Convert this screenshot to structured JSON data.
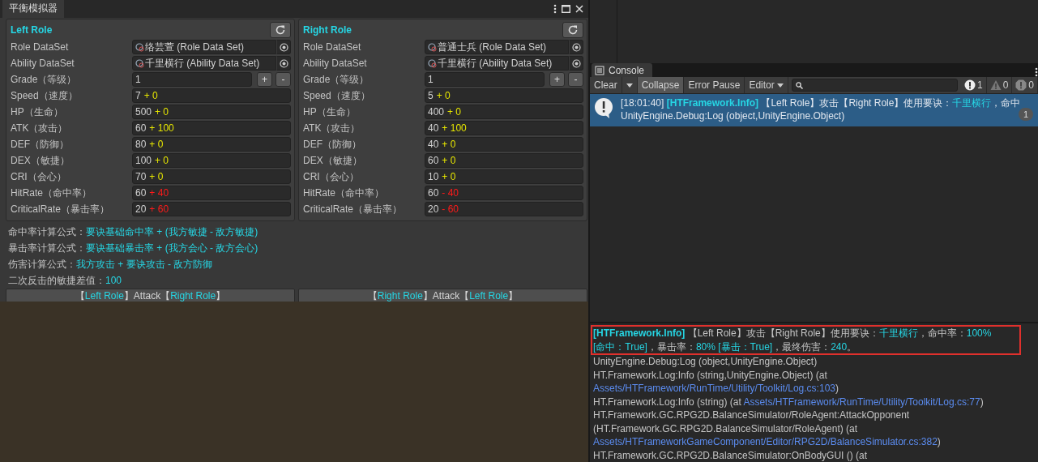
{
  "window": {
    "tab": "平衡模拟器"
  },
  "roles": [
    {
      "title": "Left Role",
      "role_dataset": {
        "label": "Role DataSet",
        "value": "络芸萱 (Role Data Set)"
      },
      "ability_dataset": {
        "label": "Ability DataSet",
        "value": "千里横行 (Ability Data Set)"
      },
      "grade": {
        "label": "Grade（等级）",
        "value": "1",
        "buttons": [
          "+",
          "-"
        ]
      },
      "stats": [
        {
          "label": "Speed（速度）",
          "base": "7",
          "modifier": "+ 0",
          "color": "#e6e600"
        },
        {
          "label": "HP（生命）",
          "base": "500",
          "modifier": "+ 0",
          "color": "#e6e600"
        },
        {
          "label": "ATK（攻击）",
          "base": "60",
          "modifier": "+ 100",
          "color": "#e6e600"
        },
        {
          "label": "DEF（防御）",
          "base": "80",
          "modifier": "+ 0",
          "color": "#e6e600"
        },
        {
          "label": "DEX（敏捷）",
          "base": "100",
          "modifier": "+ 0",
          "color": "#e6e600"
        },
        {
          "label": "CRI（会心）",
          "base": "70",
          "modifier": "+ 0",
          "color": "#e6e600"
        },
        {
          "label": "HitRate（命中率）",
          "base": "60",
          "modifier": "+ 40",
          "color": "#ff1a1a"
        },
        {
          "label": "CriticalRate（暴击率）",
          "base": "20",
          "modifier": "+ 60",
          "color": "#ff1a1a"
        }
      ]
    },
    {
      "title": "Right Role",
      "role_dataset": {
        "label": "Role DataSet",
        "value": "普通士兵 (Role Data Set)"
      },
      "ability_dataset": {
        "label": "Ability DataSet",
        "value": "千里横行 (Ability Data Set)"
      },
      "grade": {
        "label": "Grade（等级）",
        "value": "1",
        "buttons": [
          "+",
          "-"
        ]
      },
      "stats": [
        {
          "label": "Speed（速度）",
          "base": "5",
          "modifier": "+ 0",
          "color": "#e6e600"
        },
        {
          "label": "HP（生命）",
          "base": "400",
          "modifier": "+ 0",
          "color": "#e6e600"
        },
        {
          "label": "ATK（攻击）",
          "base": "40",
          "modifier": "+ 100",
          "color": "#e6e600"
        },
        {
          "label": "DEF（防御）",
          "base": "40",
          "modifier": "+ 0",
          "color": "#e6e600"
        },
        {
          "label": "DEX（敏捷）",
          "base": "60",
          "modifier": "+ 0",
          "color": "#e6e600"
        },
        {
          "label": "CRI（会心）",
          "base": "10",
          "modifier": "+ 0",
          "color": "#e6e600"
        },
        {
          "label": "HitRate（命中率）",
          "base": "60",
          "modifier": "- 40",
          "color": "#ff1a1a"
        },
        {
          "label": "CriticalRate（暴击率）",
          "base": "20",
          "modifier": "- 60",
          "color": "#ff1a1a"
        }
      ]
    }
  ],
  "formulas": [
    {
      "label": "命中率计算公式：",
      "value": "要诀基础命中率 + (我方敏捷 - 敌方敏捷)"
    },
    {
      "label": "暴击率计算公式：",
      "value": "要诀基础暴击率 + (我方会心 - 敌方会心)"
    },
    {
      "label": "伤害计算公式：",
      "value": "我方攻击 + 要诀攻击 - 敌方防御"
    },
    {
      "label": "二次反击的敏捷差值：",
      "value": "100"
    }
  ],
  "attack_buttons": [
    {
      "parts": [
        {
          "text": "【",
          "highlight": false
        },
        {
          "text": "Left Role",
          "highlight": true
        },
        {
          "text": "】Attack【",
          "highlight": false
        },
        {
          "text": "Right Role",
          "highlight": true
        },
        {
          "text": "】",
          "highlight": false
        }
      ]
    },
    {
      "parts": [
        {
          "text": "【",
          "highlight": false
        },
        {
          "text": "Right Role",
          "highlight": true
        },
        {
          "text": "】Attack【",
          "highlight": false
        },
        {
          "text": "Left Role",
          "highlight": true
        },
        {
          "text": "】",
          "highlight": false
        }
      ]
    }
  ],
  "console": {
    "tab": "Console",
    "toolbar": [
      {
        "label": "Clear",
        "kind": "button",
        "selected": false
      },
      {
        "kind": "dropdown",
        "selected": false
      },
      {
        "label": "Collapse",
        "kind": "button",
        "selected": true
      },
      {
        "label": "Error Pause",
        "kind": "button",
        "selected": false
      },
      {
        "label": "Editor",
        "kind": "dropdown",
        "selected": false
      }
    ],
    "counts": [
      {
        "kind": "info",
        "value": "1"
      },
      {
        "kind": "warning",
        "value": "0"
      },
      {
        "kind": "error",
        "value": "0"
      }
    ],
    "messages": [
      {
        "selected": true,
        "count": "1",
        "lines": [
          [
            {
              "text": "[18:01:40] ",
              "kind": "plain"
            },
            {
              "text": "[HTFramework.Info]",
              "kind": "accent"
            },
            {
              "text": " 【Left Role】攻击【Right Role】使用要诀：",
              "kind": "plain"
            },
            {
              "text": "千里横行",
              "kind": "accent"
            },
            {
              "text": "，命中",
              "kind": "plain"
            }
          ],
          [
            {
              "text": "UnityEngine.Debug:Log (object,UnityEngine.Object)",
              "kind": "plain"
            }
          ]
        ]
      }
    ],
    "detail": {
      "lines": [
        {
          "highlighted": true,
          "segments": [
            {
              "text": "[HTFramework.Info]",
              "kind": "accent"
            },
            {
              "text": " 【Left Role】攻击【Right Role】使用要诀：",
              "kind": "plain"
            },
            {
              "text": "千里横行",
              "kind": "accent"
            },
            {
              "text": "，命中率：",
              "kind": "plain"
            },
            {
              "text": "100%",
              "kind": "accent"
            }
          ]
        },
        {
          "highlighted": true,
          "segments": [
            {
              "text": "[命中：True]",
              "kind": "accent"
            },
            {
              "text": "，暴击率：",
              "kind": "plain"
            },
            {
              "text": "80% [暴击：True]",
              "kind": "accent"
            },
            {
              "text": "，最终伤害：",
              "kind": "plain"
            },
            {
              "text": "240",
              "kind": "accent"
            },
            {
              "text": "。",
              "kind": "plain"
            }
          ]
        },
        {
          "highlighted": false,
          "segments": [
            {
              "text": "UnityEngine.Debug:Log (object,UnityEngine.Object)",
              "kind": "plain"
            }
          ]
        },
        {
          "highlighted": false,
          "segments": [
            {
              "text": "HT.Framework.Log:Info (string,UnityEngine.Object) (at",
              "kind": "plain"
            }
          ]
        },
        {
          "highlighted": false,
          "segments": [
            {
              "text": "Assets/HTFramework/RunTime/Utility/Toolkit/Log.cs:103",
              "kind": "link"
            },
            {
              "text": ")",
              "kind": "plain"
            }
          ]
        },
        {
          "highlighted": false,
          "segments": [
            {
              "text": "HT.Framework.Log:Info (string) (at ",
              "kind": "plain"
            },
            {
              "text": "Assets/HTFramework/RunTime/Utility/Toolkit/Log.cs:77",
              "kind": "link"
            },
            {
              "text": ")",
              "kind": "plain"
            }
          ]
        },
        {
          "highlighted": false,
          "segments": [
            {
              "text": "HT.Framework.GC.RPG2D.BalanceSimulator/RoleAgent:AttackOpponent",
              "kind": "plain"
            }
          ]
        },
        {
          "highlighted": false,
          "segments": [
            {
              "text": "(HT.Framework.GC.RPG2D.BalanceSimulator/RoleAgent) (at",
              "kind": "plain"
            }
          ]
        },
        {
          "highlighted": false,
          "segments": [
            {
              "text": "Assets/HTFrameworkGameComponent/Editor/RPG2D/BalanceSimulator.cs:382",
              "kind": "link"
            },
            {
              "text": ")",
              "kind": "plain"
            }
          ]
        },
        {
          "highlighted": false,
          "segments": [
            {
              "text": "HT.Framework.GC.RPG2D.BalanceSimulator:OnBodyGUI () (at",
              "kind": "plain"
            }
          ]
        }
      ]
    }
  }
}
